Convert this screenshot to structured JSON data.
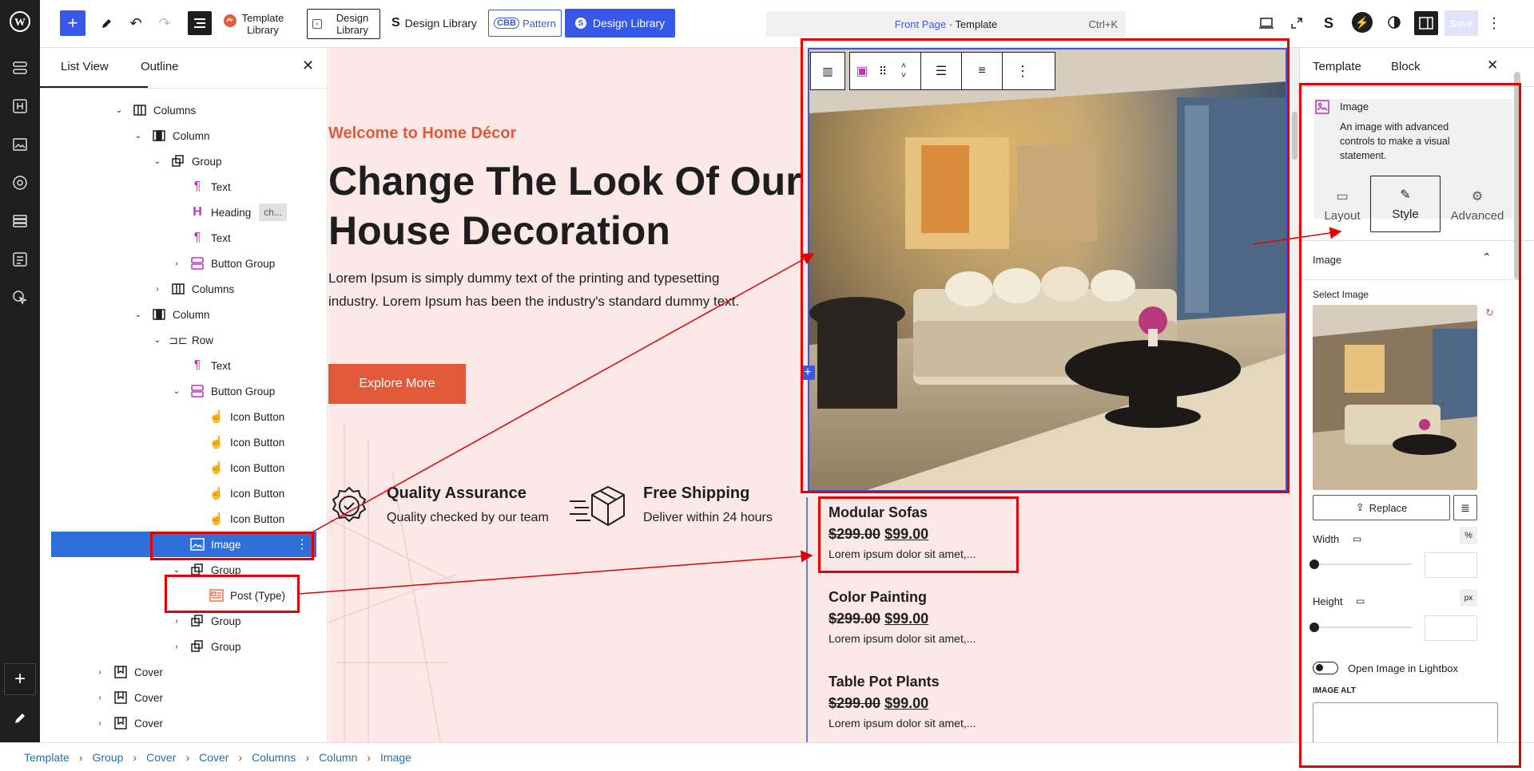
{
  "toolbar": {
    "template_library_label": "Template Library",
    "design_library_btn1": "Design Library",
    "design_library_btn2": "Design Library",
    "pattern_label": "Pattern",
    "cbb_label": "CBB",
    "design_library_blue": "Design Library",
    "doc_title_page": "Front Page",
    "doc_title_sep": " · ",
    "doc_title_type": "Template",
    "shortcut": "Ctrl+K",
    "save_label": "Save"
  },
  "listview": {
    "tab_list": "List View",
    "tab_outline": "Outline",
    "items": [
      {
        "label": "Columns",
        "badge": ""
      },
      {
        "label": "Column",
        "badge": ""
      },
      {
        "label": "Group",
        "badge": ""
      },
      {
        "label": "Text",
        "badge": ""
      },
      {
        "label": "Heading",
        "badge": "ch..."
      },
      {
        "label": "Text",
        "badge": ""
      },
      {
        "label": "Button Group",
        "badge": ""
      },
      {
        "label": "Columns",
        "badge": ""
      },
      {
        "label": "Column",
        "badge": ""
      },
      {
        "label": "Row",
        "badge": ""
      },
      {
        "label": "Text",
        "badge": ""
      },
      {
        "label": "Button Group",
        "badge": ""
      },
      {
        "label": "Icon Button",
        "badge": ""
      },
      {
        "label": "Icon Button",
        "badge": ""
      },
      {
        "label": "Icon Button",
        "badge": ""
      },
      {
        "label": "Icon Button",
        "badge": ""
      },
      {
        "label": "Icon Button",
        "badge": ""
      },
      {
        "label": "Image",
        "badge": ""
      },
      {
        "label": "Group",
        "badge": ""
      },
      {
        "label": "Post (Type)",
        "badge": ""
      },
      {
        "label": "Group",
        "badge": ""
      },
      {
        "label": "Group",
        "badge": ""
      },
      {
        "label": "Cover",
        "badge": ""
      },
      {
        "label": "Cover",
        "badge": ""
      },
      {
        "label": "Cover",
        "badge": ""
      }
    ]
  },
  "canvas": {
    "eyebrow": "Welcome to Home Décor",
    "heading_line1": "Change The Look Of Our",
    "heading_line2": "House Decoration",
    "body_line1": "Lorem Ipsum is simply dummy text of the printing and typesetting",
    "body_line2": "industry. Lorem Ipsum has been the industry's standard dummy text.",
    "cta": "Explore More",
    "features": [
      {
        "title": "Quality Assurance",
        "desc": "Quality checked by our team",
        "icon": "badge-check-icon"
      },
      {
        "title": "Free Shipping",
        "desc": "Deliver within 24 hours",
        "icon": "delivery-box-icon"
      }
    ],
    "products": [
      {
        "name": "Modular Sofas",
        "old_price": "$299.00",
        "price": "$99.00",
        "desc": "Lorem ipsum dolor sit amet,..."
      },
      {
        "name": "Color Painting",
        "old_price": "$299.00",
        "price": "$99.00",
        "desc": "Lorem ipsum dolor sit amet,..."
      },
      {
        "name": "Table Pot Plants",
        "old_price": "$299.00",
        "price": "$99.00",
        "desc": "Lorem ipsum dolor sit amet,..."
      }
    ]
  },
  "rpanel": {
    "tab_template": "Template",
    "tab_block": "Block",
    "block_name": "Image",
    "block_desc": "An image with advanced controls to make a visual statement.",
    "subtab_layout": "Layout",
    "subtab_style": "Style",
    "subtab_advanced": "Advanced",
    "section_image": "Image",
    "select_image": "Select Image",
    "replace": "Replace",
    "width_label": "Width",
    "width_unit": "%",
    "height_label": "Height",
    "height_unit": "px",
    "lightbox_label": "Open Image in Lightbox",
    "alt_label": "IMAGE ALT"
  },
  "breadcrumbs": [
    "Template",
    "Group",
    "Cover",
    "Cover",
    "Columns",
    "Column",
    "Image"
  ],
  "colors": {
    "accent_blue": "#3858e9",
    "selection_blue": "#2f6fd9",
    "brand_red": "#e05a3a",
    "canvas_bg": "#fce8e6",
    "annotation_red": "#e40000"
  }
}
